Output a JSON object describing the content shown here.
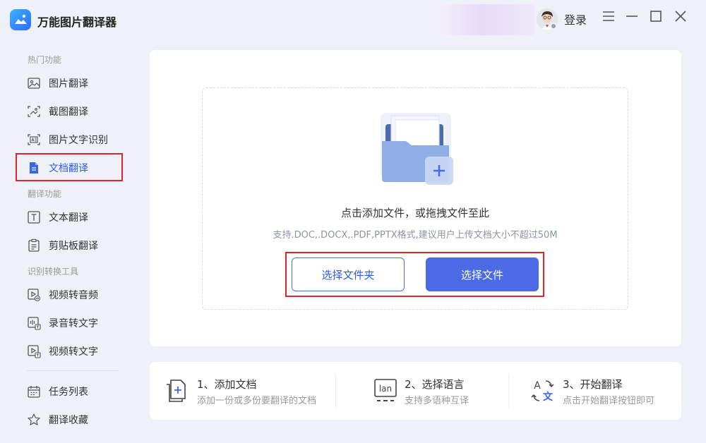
{
  "app": {
    "title": "万能图片翻译器",
    "login_label": "登录"
  },
  "sidebar": {
    "sections": [
      {
        "label": "热门功能"
      },
      {
        "label": "翻译功能"
      },
      {
        "label": "识别转换工具"
      }
    ],
    "items": [
      {
        "label": "图片翻译",
        "icon": "image-icon"
      },
      {
        "label": "截图翻译",
        "icon": "screenshot-icon"
      },
      {
        "label": "图片文字识别",
        "icon": "ocr-icon"
      },
      {
        "label": "文档翻译",
        "icon": "document-icon",
        "active": true
      },
      {
        "label": "文本翻译",
        "icon": "text-icon"
      },
      {
        "label": "剪贴板翻译",
        "icon": "clipboard-icon"
      },
      {
        "label": "视频转音频",
        "icon": "video-audio-icon"
      },
      {
        "label": "录音转文字",
        "icon": "recording-text-icon"
      },
      {
        "label": "视频转文字",
        "icon": "video-text-icon"
      },
      {
        "label": "任务列表",
        "icon": "calendar-icon"
      },
      {
        "label": "翻译收藏",
        "icon": "star-icon"
      }
    ]
  },
  "upload": {
    "title": "点击添加文件，或拖拽文件至此",
    "hint": "支持.DOC,.DOCX,.PDF,PPTX格式,建议用户上传文档大小不超过50M",
    "select_folder": "选择文件夹",
    "select_file": "选择文件"
  },
  "steps": [
    {
      "title": "1、添加文档",
      "desc": "添加一份或多份要翻译的文档"
    },
    {
      "title": "2、选择语言",
      "desc": "支持多语种互译",
      "icon_text": "lan"
    },
    {
      "title": "3、开始翻译",
      "desc": "点击开始翻译按钮即可",
      "icon_text_a": "A",
      "icon_text_b": "文"
    }
  ],
  "colors": {
    "accent": "#4b6be6",
    "highlight": "#e0242e",
    "background": "#eef1f7"
  }
}
